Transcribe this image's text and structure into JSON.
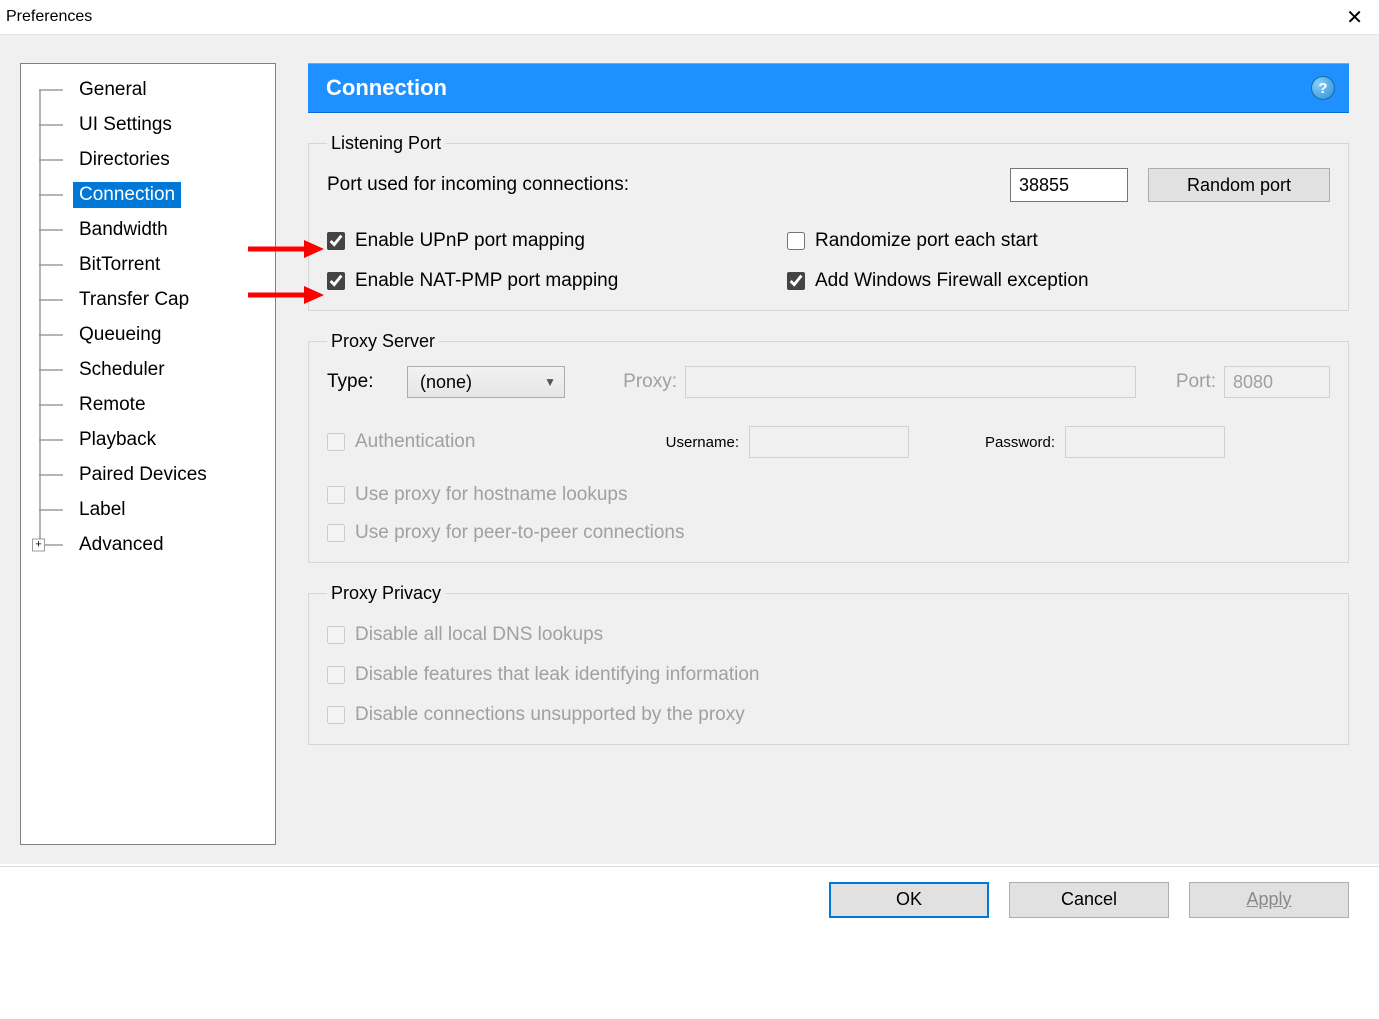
{
  "window": {
    "title": "Preferences"
  },
  "sidebar": {
    "items": [
      {
        "label": "General"
      },
      {
        "label": "UI Settings"
      },
      {
        "label": "Directories"
      },
      {
        "label": "Connection"
      },
      {
        "label": "Bandwidth"
      },
      {
        "label": "BitTorrent"
      },
      {
        "label": "Transfer Cap"
      },
      {
        "label": "Queueing"
      },
      {
        "label": "Scheduler"
      },
      {
        "label": "Remote"
      },
      {
        "label": "Playback"
      },
      {
        "label": "Paired Devices"
      },
      {
        "label": "Label"
      },
      {
        "label": "Advanced"
      }
    ],
    "selected_index": 3
  },
  "panel": {
    "title": "Connection",
    "listening": {
      "legend": "Listening Port",
      "port_label": "Port used for incoming connections:",
      "port_value": "38855",
      "random_label": "Random port",
      "upnp": "Enable UPnP port mapping",
      "natpmp": "Enable NAT-PMP port mapping",
      "randomize": "Randomize port each start",
      "firewall": "Add Windows Firewall exception"
    },
    "proxy": {
      "legend": "Proxy Server",
      "type_label": "Type:",
      "type_value": "(none)",
      "proxy_label": "Proxy:",
      "port_label": "Port:",
      "port_value": "8080",
      "auth": "Authentication",
      "user_label": "Username:",
      "pass_label": "Password:",
      "hostname_lookup": "Use proxy for hostname lookups",
      "p2p": "Use proxy for peer-to-peer connections"
    },
    "privacy": {
      "legend": "Proxy Privacy",
      "dns": "Disable all local DNS lookups",
      "leak": "Disable features that leak identifying information",
      "unsupported": "Disable connections unsupported by the proxy"
    }
  },
  "buttons": {
    "ok": "OK",
    "cancel": "Cancel",
    "apply": "Apply"
  }
}
